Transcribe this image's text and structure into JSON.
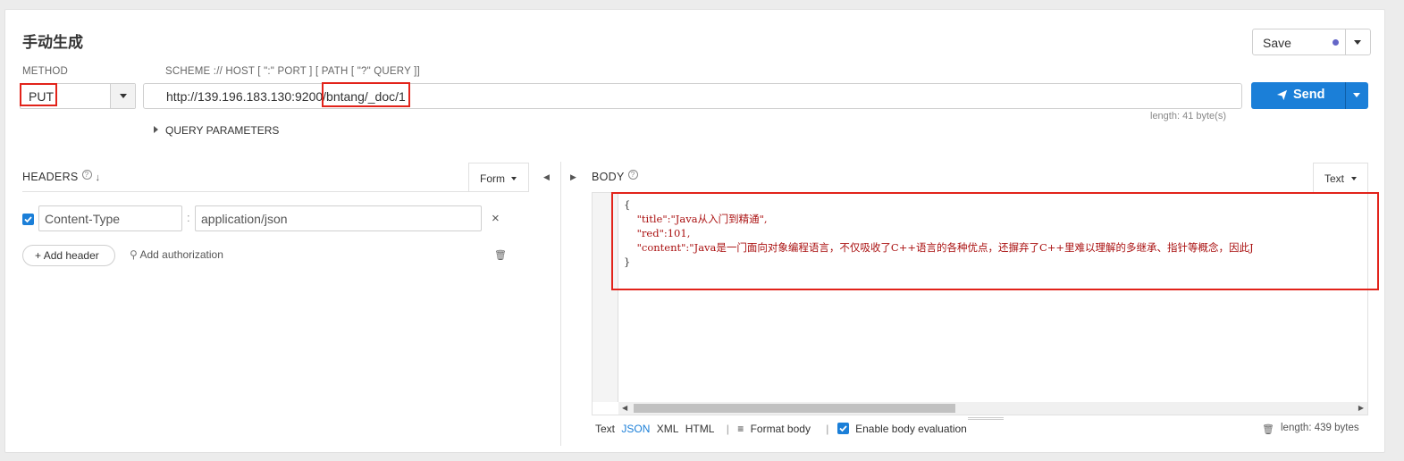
{
  "page": {
    "title": "手动生成",
    "save_label": "Save",
    "method_label": "METHOD",
    "url_hint": "SCHEME :// HOST [ \":\" PORT ] [ PATH [ \"?\" QUERY ]]",
    "method_value": "PUT",
    "url_value": "http://139.196.183.130:9200/bntang/_doc/1",
    "send_label": "Send",
    "url_length": "length: 41 byte(s)",
    "query_parameters": "QUERY PARAMETERS"
  },
  "headers": {
    "label": "HEADERS",
    "mode": "Form",
    "rows": [
      {
        "name": "Content-Type",
        "value": "application/json",
        "enabled": true
      }
    ],
    "add_header": "Add header",
    "add_authorization": "Add authorization"
  },
  "body": {
    "label": "BODY",
    "mode": "Text",
    "lines": [
      "{",
      "    \"title\":\"Java从入门到精通\",",
      "    \"red\":101,",
      "    \"content\":\"Java是一门面向对象编程语言，不仅吸收了C++语言的各种优点，还摒弃了C++里难以理解的多继承、指针等概念，因此J",
      "}"
    ],
    "formats": [
      "Text",
      "JSON",
      "XML",
      "HTML"
    ],
    "active_format": "JSON",
    "format_body": "Format body",
    "enable_eval": "Enable body evaluation",
    "length": "length: 439 bytes"
  },
  "colors": {
    "accent": "#1b7fd8",
    "highlight": "#e2231a"
  }
}
